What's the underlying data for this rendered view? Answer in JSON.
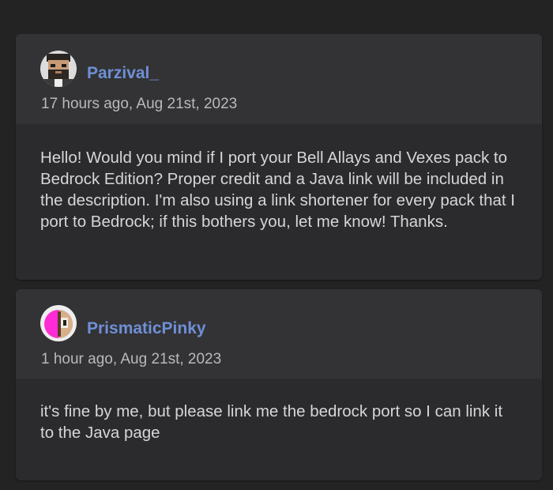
{
  "comments": [
    {
      "author": "Parzival_",
      "timestamp": "17 hours ago, Aug 21st, 2023",
      "body": "Hello! Would you mind if I port your Bell Allays and Vexes pack to Bedrock Edition? Proper credit and a Java link will be included in the description. I'm also using a link shortener for every pack that I port to Bedrock; if this bothers you, let me know! Thanks.",
      "avatar_icon": "pixel-bearded-man-avatar"
    },
    {
      "author": "PrismaticPinky",
      "timestamp": "1 hour ago, Aug 21st, 2023",
      "body": "it's fine by me, but please link me the bedrock port so I can link it to the Java page",
      "avatar_icon": "pink-character-avatar"
    }
  ],
  "colors": {
    "background": "#232323",
    "card": "#2b2b2d",
    "card_header": "#333335",
    "author_link": "#6f8fd6",
    "timestamp": "#b9b9bd",
    "body_text": "#d6d6da"
  }
}
